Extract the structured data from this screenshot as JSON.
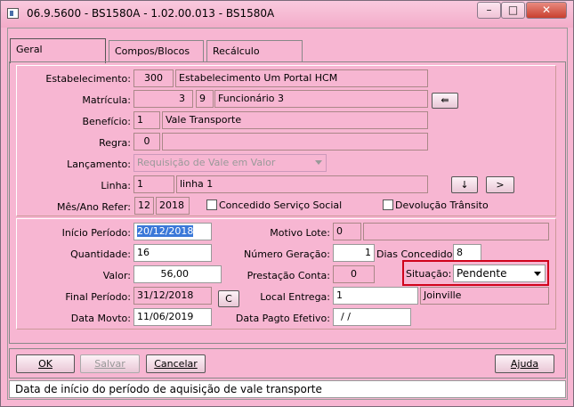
{
  "window": {
    "title": "06.9.5600 - BS1580A - 1.02.00.013 - BS1580A",
    "min_glyph": "–",
    "max_glyph": "□",
    "close_glyph": "✕"
  },
  "tabs": [
    {
      "label": "Geral",
      "active": true
    },
    {
      "label": "Compos/Blocos",
      "active": false
    },
    {
      "label": "Recálculo",
      "active": false
    }
  ],
  "top": {
    "estabelecimento": {
      "label": "Estabelecimento:",
      "code": "300",
      "name": "Estabelecimento Um Portal HCM"
    },
    "matricula": {
      "label": "Matrícula:",
      "code": "3",
      "digit": "9",
      "name": "Funcionário 3",
      "button_glyph": "⇚"
    },
    "beneficio": {
      "label": "Benefício:",
      "code": "1",
      "name": "Vale Transporte"
    },
    "regra": {
      "label": "Regra:",
      "code": "0",
      "name": ""
    },
    "lancamento": {
      "label": "Lançamento:",
      "value": "Requisição de Vale em Valor"
    },
    "linha": {
      "label": "Linha:",
      "code": "1",
      "name": "linha 1",
      "btn_down": "↓",
      "btn_next": ">"
    },
    "mes_ano": {
      "label": "Mês/Ano Refer:",
      "mes": "12",
      "ano": "2018"
    },
    "concedido_servico_social": {
      "label": "Concedido Serviço Social",
      "checked": false
    },
    "devolucao_transito": {
      "label": "Devolução Trânsito",
      "checked": false
    }
  },
  "bottom": {
    "inicio_periodo": {
      "label": "Início Período:",
      "value": "20/12/2018"
    },
    "motivo_lote": {
      "label": "Motivo Lote:",
      "code": "0",
      "name": ""
    },
    "quantidade": {
      "label": "Quantidade:",
      "value": "16"
    },
    "numero_geracao": {
      "label": "Número Geração:",
      "value": "1"
    },
    "dias_concedidos": {
      "label": "Dias Concedidos:",
      "value": "8"
    },
    "valor": {
      "label": "Valor:",
      "value": "56,00"
    },
    "prestacao_conta": {
      "label": "Prestação Conta:",
      "value": "0"
    },
    "situacao": {
      "label": "Situação:",
      "value": "Pendente"
    },
    "final_periodo": {
      "label": "Final Período:",
      "value": "31/12/2018",
      "button": "C"
    },
    "local_entrega": {
      "label": "Local Entrega:",
      "code": "1",
      "name": "Joinville"
    },
    "data_movto": {
      "label": "Data Movto:",
      "value": "11/06/2019"
    },
    "data_pagto_efetivo": {
      "label": "Data Pagto Efetivo:",
      "value": "/ /"
    }
  },
  "buttons": {
    "ok": "OK",
    "salvar": "Salvar",
    "cancelar": "Cancelar",
    "ajuda": "Ajuda"
  },
  "status_text": "Data de início do período de aquisição de vale transporte",
  "colors": {
    "background": "#f7b6d2",
    "highlight_border": "#d0021b",
    "selection": "#3a78d8"
  }
}
